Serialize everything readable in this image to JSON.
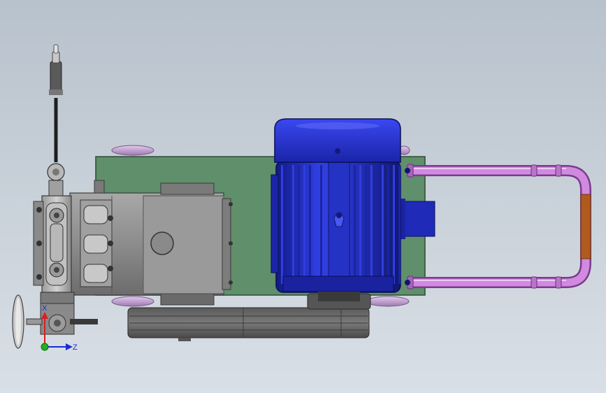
{
  "colors": {
    "background_top": "#b8c2cc",
    "background_bottom": "#d9dfe6",
    "base_plate": "#5f8f6b",
    "motor_blue": "#2430c4",
    "motor_blue_dark": "#111a7a",
    "pump_steel": "#8a8a8a",
    "hose_purple": "#c77ad8",
    "hose_coupler": "#b05a1e",
    "belt_guard": "#6a6a6a"
  },
  "triad": {
    "axis_x_label": "X",
    "axis_z_label": "Z",
    "axis_x_color": "#d62020",
    "axis_z_color": "#1b2bd6",
    "origin_color": "#22b022"
  },
  "components": [
    {
      "name": "base-plate"
    },
    {
      "name": "electric-motor"
    },
    {
      "name": "plunger-pump"
    },
    {
      "name": "belt-guard"
    },
    {
      "name": "bypass-hose"
    },
    {
      "name": "pressure-gauge"
    },
    {
      "name": "handwheel-valve"
    }
  ]
}
